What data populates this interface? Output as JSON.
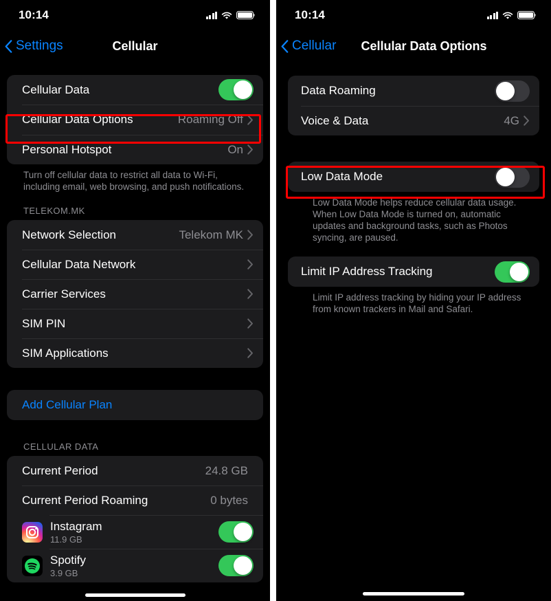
{
  "left": {
    "status_bar": {
      "time": "10:14",
      "signal_icon": "cellular-signal-icon",
      "wifi_icon": "wifi-icon",
      "battery_icon": "battery-icon"
    },
    "nav": {
      "back_label": "Settings",
      "title": "Cellular",
      "back_icon": "chevron-left-icon"
    },
    "section_main": {
      "rows": [
        {
          "label": "Cellular Data",
          "control": "toggle",
          "state": "on"
        },
        {
          "label": "Cellular Data Options",
          "value": "Roaming Off",
          "control": "chevron",
          "highlighted": true
        },
        {
          "label": "Personal Hotspot",
          "value": "On",
          "control": "chevron"
        }
      ],
      "footnote": "Turn off cellular data to restrict all data to Wi-Fi, including email, web browsing, and push notifications."
    },
    "section_carrier": {
      "header": "TELEKOM.MK",
      "rows": [
        {
          "label": "Network Selection",
          "value": "Telekom MK",
          "control": "chevron"
        },
        {
          "label": "Cellular Data Network",
          "value": "",
          "control": "chevron"
        },
        {
          "label": "Carrier Services",
          "value": "",
          "control": "chevron"
        },
        {
          "label": "SIM PIN",
          "value": "",
          "control": "chevron"
        },
        {
          "label": "SIM Applications",
          "value": "",
          "control": "chevron"
        }
      ]
    },
    "section_plan": {
      "rows": [
        {
          "label": "Add Cellular Plan"
        }
      ]
    },
    "section_usage": {
      "header": "CELLULAR DATA",
      "rows": [
        {
          "label": "Current Period",
          "value": "24.8 GB"
        },
        {
          "label": "Current Period Roaming",
          "value": "0 bytes"
        }
      ],
      "apps": [
        {
          "name": "Instagram",
          "size": "11.9 GB",
          "icon": "instagram-app-icon",
          "state": "on"
        },
        {
          "name": "Spotify",
          "size": "3.9 GB",
          "icon": "spotify-app-icon",
          "state": "on"
        }
      ]
    }
  },
  "right": {
    "status_bar": {
      "time": "10:14",
      "signal_icon": "cellular-signal-icon",
      "wifi_icon": "wifi-icon",
      "battery_icon": "battery-icon"
    },
    "nav": {
      "back_label": "Cellular",
      "title": "Cellular Data Options",
      "back_icon": "chevron-left-icon"
    },
    "section_roaming": {
      "rows": [
        {
          "label": "Data Roaming",
          "control": "toggle",
          "state": "off"
        },
        {
          "label": "Voice & Data",
          "value": "4G",
          "control": "chevron"
        }
      ]
    },
    "section_lowdata": {
      "rows": [
        {
          "label": "Low Data Mode",
          "control": "toggle",
          "state": "off",
          "highlighted": true
        }
      ],
      "footnote": "Low Data Mode helps reduce cellular data usage. When Low Data Mode is turned on, automatic updates and background tasks, such as Photos syncing, are paused."
    },
    "section_iptracking": {
      "rows": [
        {
          "label": "Limit IP Address Tracking",
          "control": "toggle",
          "state": "on"
        }
      ],
      "footnote": "Limit IP address tracking by hiding your IP address from known trackers in Mail and Safari."
    }
  },
  "colors": {
    "accent_blue": "#0a84ff",
    "toggle_on": "#34c759",
    "toggle_off": "#39393d",
    "card_bg": "#1c1c1e",
    "secondary_text": "#8e8e93",
    "highlight": "#ff0000"
  }
}
